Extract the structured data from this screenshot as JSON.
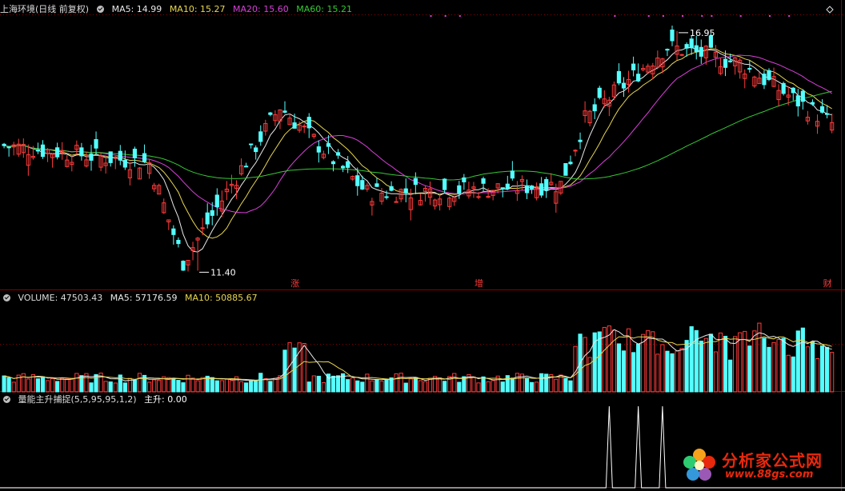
{
  "colors": {
    "up": "#ff3b3b",
    "down": "#54ffff",
    "ma5": "#e8e8e8",
    "ma10": "#e8d64f",
    "ma20": "#d93fd9",
    "ma60": "#35c935",
    "grid": "#8b0000",
    "text": "#dcdcdc",
    "white": "#ffffff"
  },
  "price_panel": {
    "stock": "上海环境(日线 前复权)",
    "ma5": "MA5: 14.99",
    "ma10": "MA10: 15.27",
    "ma20": "MA20: 15.60",
    "ma60": "MA60: 15.21",
    "high_label": "16.95",
    "low_label": "11.40",
    "markers": [
      "涨",
      "增",
      "财"
    ]
  },
  "volume_panel": {
    "volume": "VOLUME: 47503.43",
    "ma5": "MA5: 57176.59",
    "ma10": "MA10: 50885.67"
  },
  "indicator_panel": {
    "name": "量能主升捕捉(5,5,95,95,1,2)",
    "value": "主升: 0.00"
  },
  "watermark": {
    "text": "分析家公式网",
    "url": "www.88gs.com"
  },
  "chart_data": [
    {
      "type": "candlestick",
      "title": "上海环境(日线 前复权)",
      "price_range": [
        11.0,
        17.3
      ],
      "high": 16.95,
      "low": 11.4,
      "key_points": [
        {
          "index": 0,
          "close": 14.3
        },
        {
          "index": 30,
          "close": 13.9
        },
        {
          "index": 37,
          "close": 11.6
        },
        {
          "index": 42,
          "close": 12.5
        },
        {
          "index": 57,
          "close": 15.2
        },
        {
          "index": 75,
          "close": 13.2
        },
        {
          "index": 100,
          "close": 13.3
        },
        {
          "index": 115,
          "close": 13.4
        },
        {
          "index": 120,
          "close": 14.9
        },
        {
          "index": 137,
          "close": 16.6
        },
        {
          "index": 152,
          "close": 16.2
        },
        {
          "index": 171,
          "close": 14.8
        }
      ],
      "series": [
        {
          "name": "MA5",
          "last": 14.99
        },
        {
          "name": "MA10",
          "last": 15.27
        },
        {
          "name": "MA20",
          "last": 15.6
        },
        {
          "name": "MA60",
          "last": 15.21
        }
      ]
    },
    {
      "type": "bar",
      "title": "VOLUME",
      "last": 47503.43,
      "series": [
        {
          "name": "MA5",
          "last": 57176.59
        },
        {
          "name": "MA10",
          "last": 50885.67
        }
      ]
    },
    {
      "type": "line",
      "title": "量能主升捕捉",
      "last": 0.0,
      "spikes": [
        125,
        131,
        136
      ]
    }
  ]
}
